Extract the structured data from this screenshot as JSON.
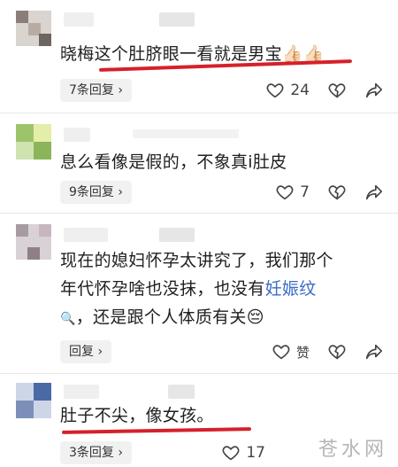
{
  "comments": [
    {
      "text_pre": "晓梅这个肚脐眼一看就是男宝",
      "text_emoji": "👍🏻👍🏻",
      "replies": "7条回复",
      "likes": "24"
    },
    {
      "text": "息么看像是假的，不象真i肚皮",
      "replies": "9条回复",
      "likes": "7"
    },
    {
      "line1": "现在的媳妇怀孕太讲究了，我们那个",
      "line2_pre": "年代怀孕啥也没抹，也没有",
      "line2_link": "妊娠纹",
      "line3_icon": "🔍",
      "line3": "，还是跟个人体质有关",
      "line3_emoji": "😔",
      "replies": "回复",
      "likes": "赞"
    },
    {
      "text": "肚子不尖，像女孩。",
      "replies": "3条回复",
      "likes": "17"
    }
  ],
  "watermark": "苍水网",
  "colors": {
    "underline": "#d6202a",
    "link": "#3b6cc7"
  }
}
